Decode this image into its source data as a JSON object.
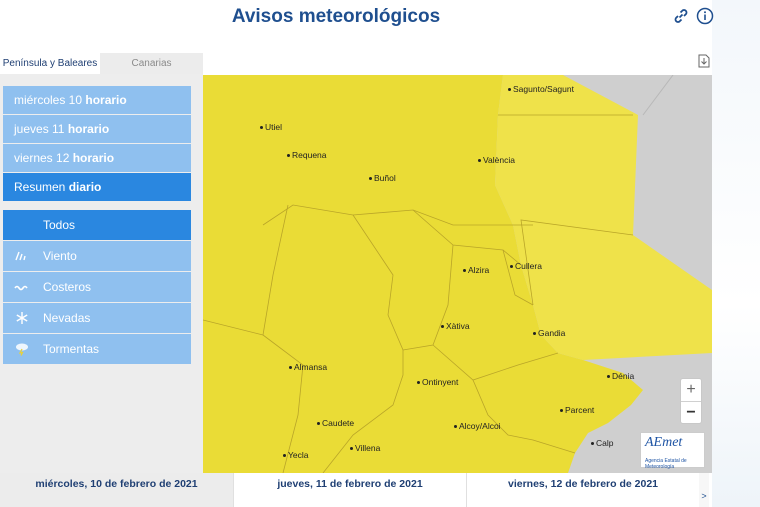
{
  "header": {
    "title": "Avisos meteorológicos",
    "link_icon": "link-icon",
    "info_icon": "info-icon"
  },
  "region_tabs": [
    {
      "label": "Península y Baleares",
      "active": true
    },
    {
      "label": "Canarias",
      "active": false
    }
  ],
  "days": [
    {
      "day": "miércoles 10",
      "mode": "horario",
      "active": false
    },
    {
      "day": "jueves 11",
      "mode": "horario",
      "active": false
    },
    {
      "day": "viernes 12",
      "mode": "horario",
      "active": false
    },
    {
      "day": "Resumen",
      "mode": "diario",
      "active": true
    }
  ],
  "warning_types": [
    {
      "label": "Todos",
      "icon": "",
      "active": true
    },
    {
      "label": "Viento",
      "icon": "wind-icon",
      "active": false
    },
    {
      "label": "Costeros",
      "icon": "waves-icon",
      "active": false
    },
    {
      "label": "Nevadas",
      "icon": "snowflake-icon",
      "active": false
    },
    {
      "label": "Tormentas",
      "icon": "storm-icon",
      "active": false
    }
  ],
  "map": {
    "towns": [
      "Sagunto/Sagunt",
      "Utiel",
      "Requena",
      "Buñol",
      "València",
      "Cullera",
      "Alzira",
      "Xàtiva",
      "Gandia",
      "Almansa",
      "Ontinyent",
      "Dénia",
      "Caudete",
      "Parcent",
      "Alcoy/Alcoi",
      "Villena",
      "Calp",
      "Yecla"
    ],
    "zoom_in_label": "+",
    "zoom_out_label": "−",
    "warning_color": "#eadc36",
    "sea_color": "#cfcfcf",
    "logo_text": "AEmet",
    "logo_subtitle": "Agencia Estatal de Meteorología"
  },
  "date_tabs": [
    {
      "label": "miércoles, 10 de febrero de 2021",
      "active": true
    },
    {
      "label": "jueves, 11 de febrero de 2021",
      "active": false
    },
    {
      "label": "viernes, 12 de febrero de 2021",
      "active": false
    }
  ],
  "next_label": ">",
  "colors": {
    "accent": "#2a87e0",
    "accent_light": "#8fc0ef",
    "title": "#1f4f8f"
  }
}
